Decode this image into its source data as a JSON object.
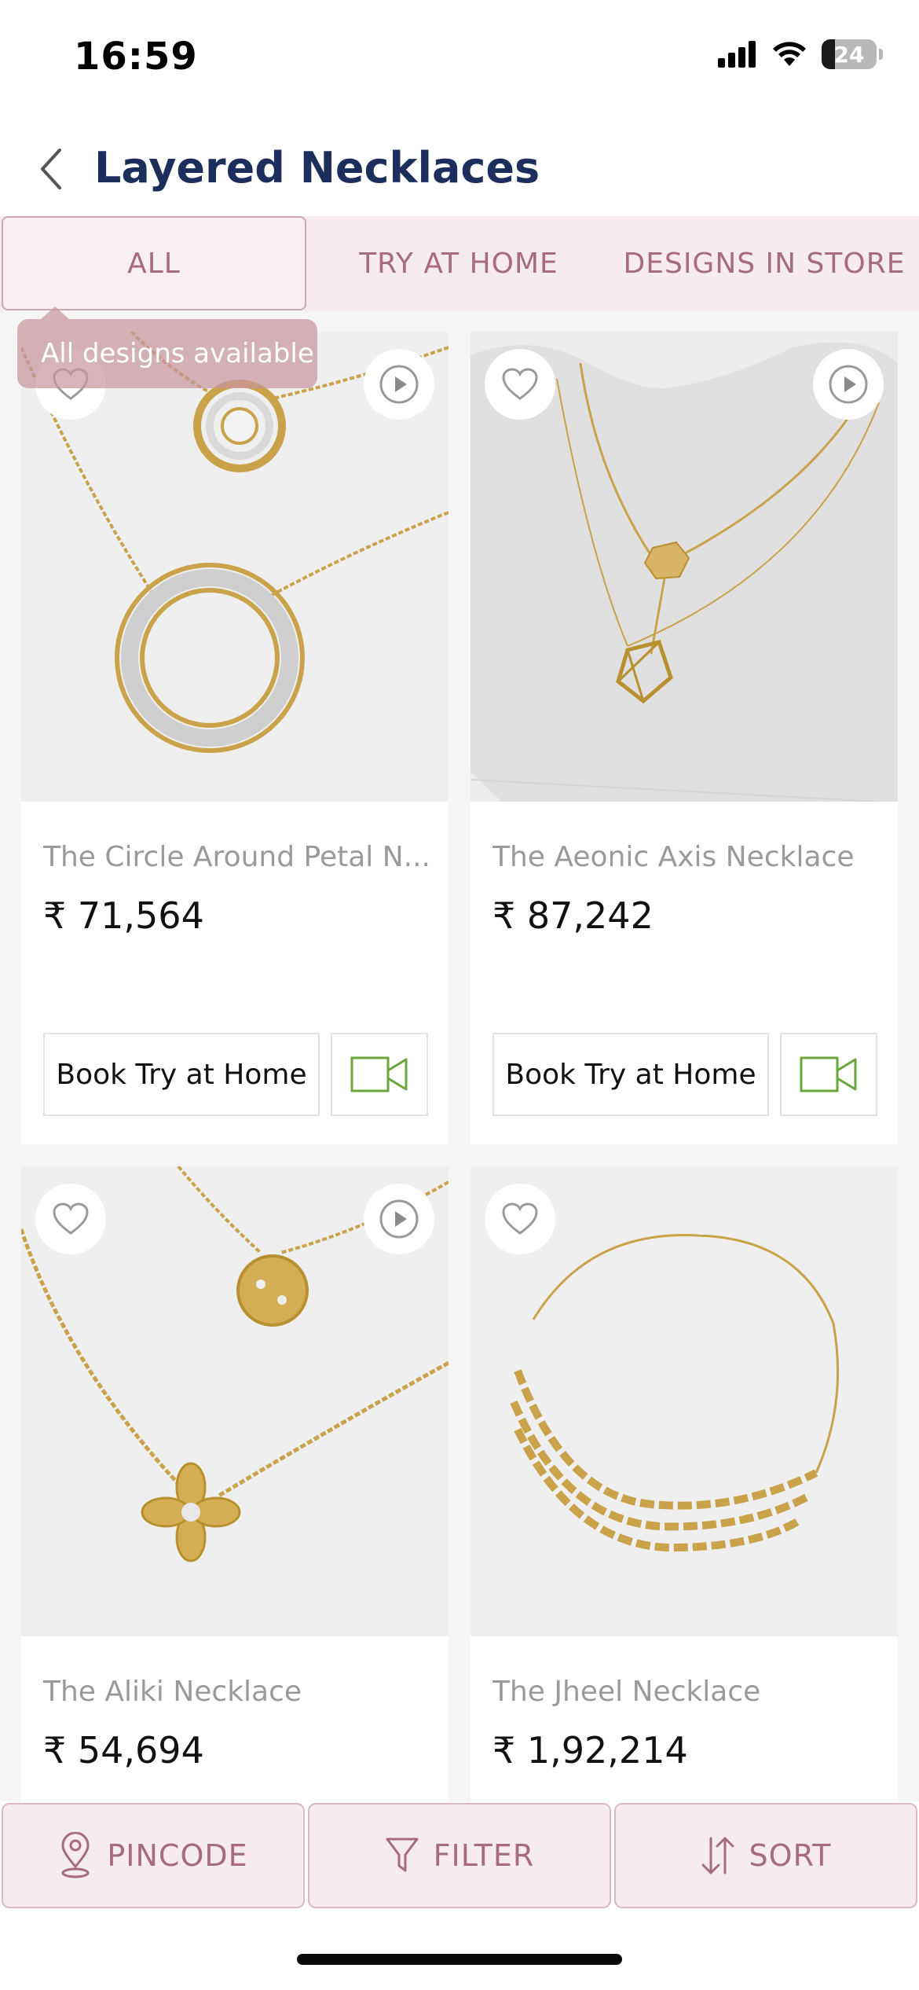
{
  "status_bar": {
    "time": "16:59",
    "battery": "24",
    "battery_fraction": 0.24,
    "icons": [
      "signal-icon",
      "wifi-icon",
      "battery-icon"
    ]
  },
  "header": {
    "title": "Layered Necklaces",
    "back_icon": "chevron-left-icon"
  },
  "tabs": [
    {
      "label": "ALL",
      "active": true
    },
    {
      "label": "TRY AT HOME",
      "active": false
    },
    {
      "label": "DESIGNS IN STORE",
      "active": false
    }
  ],
  "tooltip": "All designs available",
  "products": [
    {
      "name": "The Circle Around Petal N...",
      "price": "₹ 71,564",
      "cta": "Book Try at Home",
      "has_video": true
    },
    {
      "name": "The Aeonic Axis Necklace",
      "price": "₹ 87,242",
      "cta": "Book Try at Home",
      "has_video": true
    },
    {
      "name": "The Aliki Necklace",
      "price": "₹ 54,694",
      "has_video": true
    },
    {
      "name": "The Jheel Necklace",
      "price": "₹ 1,92,214",
      "has_video": false
    }
  ],
  "bottom_bar": {
    "pincode": "PINCODE",
    "filter": "FILTER",
    "sort": "SORT"
  },
  "colors": {
    "title": "#1c2f5c",
    "accent": "#a66b7e",
    "tab_bg": "#f6ebed",
    "video_icon": "#6aa63a"
  }
}
